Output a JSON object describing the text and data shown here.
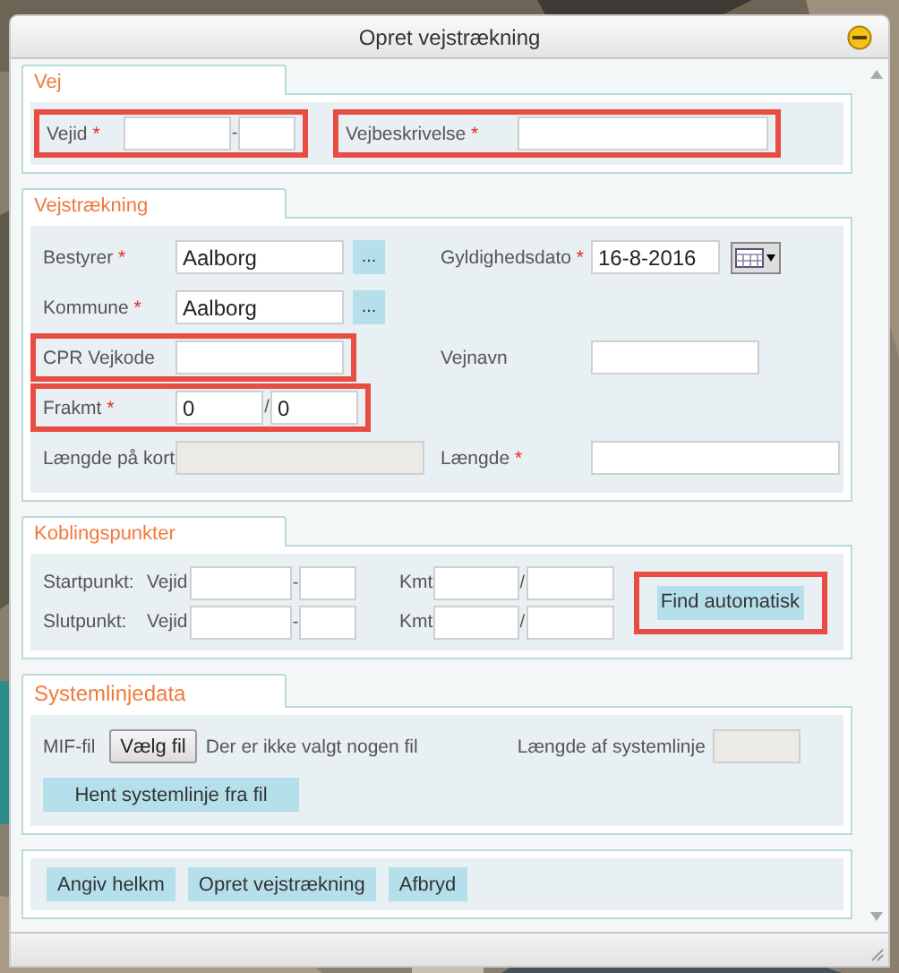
{
  "window": {
    "title": "Opret vejstrækning"
  },
  "vej": {
    "title": "Vej",
    "fields": [
      {
        "label": "Vejid",
        "mark": "*",
        "highlighted": true,
        "kind": "split",
        "separator": "-"
      },
      {
        "label": "Vejbeskrivelse",
        "mark": "*",
        "highlighted": true,
        "kind": "text"
      }
    ]
  },
  "vejstraekning": {
    "title": "Vejstrækning",
    "rows": [
      {
        "left": {
          "label": "Bestyrer",
          "mark": "*",
          "highlighted": false,
          "kind": "text",
          "value": "Aalborg",
          "button": "..."
        },
        "right": {
          "label": "Gyldighedsdato",
          "mark": "*",
          "highlighted": false,
          "kind": "date",
          "value": "16-8-2016"
        }
      },
      {
        "left": {
          "label": "Kommune",
          "mark": "*",
          "highlighted": false,
          "kind": "text",
          "value": "Aalborg",
          "button": "..."
        }
      },
      {
        "left": {
          "label": "CPR Vejkode",
          "highlighted": true,
          "kind": "text"
        },
        "right": {
          "label": "Vejnavn",
          "highlighted": false,
          "kind": "text"
        }
      },
      {
        "left": {
          "label": "Frakmt",
          "mark": "*",
          "highlighted": true,
          "kind": "split",
          "separator": "/",
          "values": [
            "0",
            "0"
          ]
        }
      },
      {
        "left": {
          "label": "Længde på kort",
          "highlighted": false,
          "kind": "readonly"
        },
        "right": {
          "label": "Længde",
          "mark": "*",
          "highlighted": false,
          "kind": "text"
        }
      }
    ]
  },
  "koblingspunkter": {
    "title": "Koblingspunkter",
    "rows": [
      {
        "label": "Startpunkt:",
        "vejid_label": "Vejid",
        "vejid_separator": "-",
        "kmt_label": "Kmt",
        "kmt_separator": "/"
      },
      {
        "label": "Slutpunkt:",
        "vejid_label": "Vejid",
        "vejid_separator": "-",
        "kmt_label": "Kmt",
        "kmt_separator": "/"
      }
    ],
    "button": {
      "label": "Find automatisk",
      "highlighted": true
    }
  },
  "systemlinjedata": {
    "title": "Systemlinjedata",
    "file_label": "MIF-fil",
    "file_button": "Vælg fil",
    "file_status": "Der er ikke valgt nogen fil",
    "length_label": "Længde af systemlinje",
    "load_button": "Hent systemlinje fra fil"
  },
  "actions": [
    "Angiv helkm",
    "Opret vejstrækning",
    "Afbryd"
  ]
}
